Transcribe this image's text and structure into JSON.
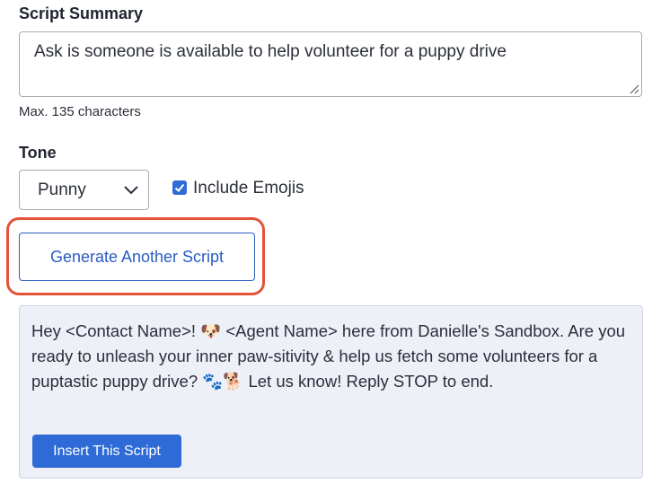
{
  "summary": {
    "label": "Script Summary",
    "value": "Ask is someone is available to help volunteer for a puppy drive",
    "hint": "Max. 135 characters"
  },
  "tone": {
    "label": "Tone",
    "selected": "Punny",
    "include_emojis_label": "Include Emojis",
    "include_emojis_checked": true
  },
  "actions": {
    "generate_label": "Generate Another Script",
    "insert_label": "Insert This Script"
  },
  "result": {
    "text": "Hey <Contact Name>! 🐶 <Agent Name> here from Danielle's Sandbox. Are you ready to unleash your inner paw-sitivity & help us fetch some volunteers for a puptastic puppy drive? 🐾🐕 Let us know! Reply STOP to end."
  },
  "colors": {
    "accent": "#2f6bd6",
    "highlight": "#e2533a",
    "card_bg": "#eef0f8"
  }
}
